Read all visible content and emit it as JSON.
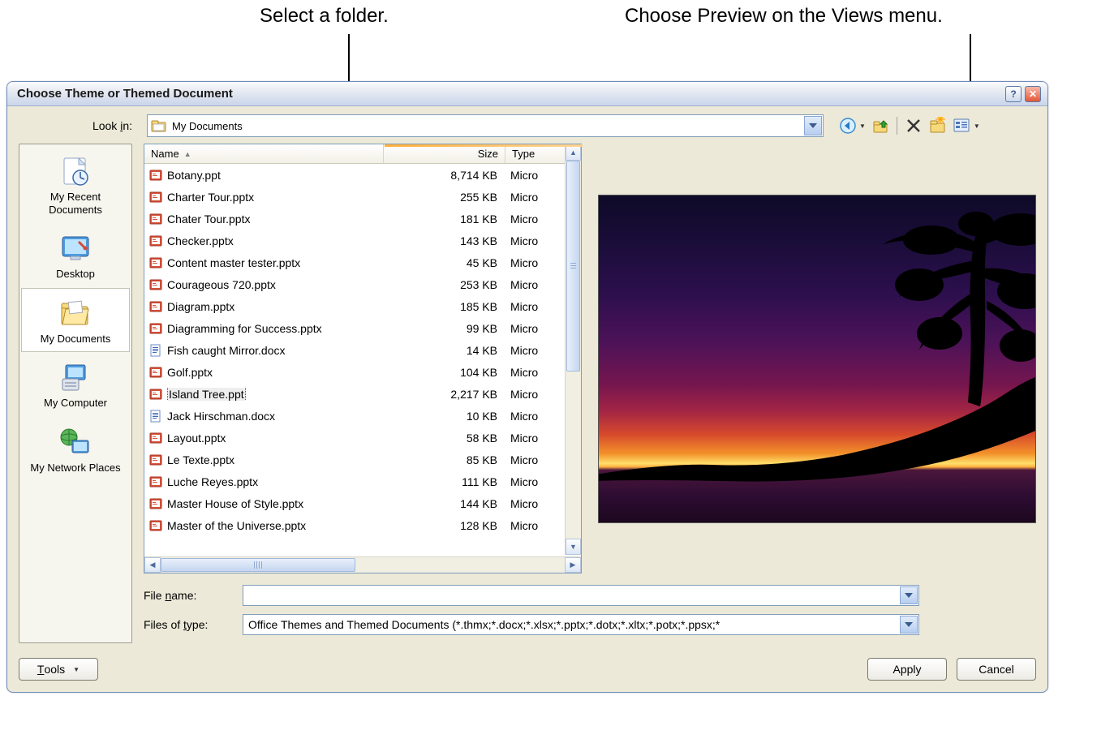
{
  "annotations": {
    "left": "Select a folder.",
    "right": "Choose Preview on the Views menu."
  },
  "dialog": {
    "title": "Choose Theme or Themed Document",
    "lookin_label": "Look in:",
    "lookin_value": "My Documents",
    "toolbar_icons": {
      "back": "back-icon",
      "up": "up-one-level-icon",
      "delete": "delete-icon",
      "newfolder": "new-folder-icon",
      "views": "views-icon"
    }
  },
  "places": [
    {
      "id": "recent",
      "label": "My Recent Documents"
    },
    {
      "id": "desktop",
      "label": "Desktop"
    },
    {
      "id": "mydocs",
      "label": "My Documents"
    },
    {
      "id": "mycomputer",
      "label": "My Computer"
    },
    {
      "id": "network",
      "label": "My Network Places"
    }
  ],
  "active_place": "mydocs",
  "columns": {
    "name": "Name",
    "size": "Size",
    "type": "Type"
  },
  "files": [
    {
      "name": "Botany.ppt",
      "size": "8,714 KB",
      "type": "Micro",
      "kind": "ppt"
    },
    {
      "name": "Charter Tour.pptx",
      "size": "255 KB",
      "type": "Micro",
      "kind": "ppt"
    },
    {
      "name": "Chater Tour.pptx",
      "size": "181 KB",
      "type": "Micro",
      "kind": "ppt"
    },
    {
      "name": "Checker.pptx",
      "size": "143 KB",
      "type": "Micro",
      "kind": "ppt"
    },
    {
      "name": "Content master tester.pptx",
      "size": "45 KB",
      "type": "Micro",
      "kind": "ppt"
    },
    {
      "name": "Courageous 720.pptx",
      "size": "253 KB",
      "type": "Micro",
      "kind": "ppt"
    },
    {
      "name": "Diagram.pptx",
      "size": "185 KB",
      "type": "Micro",
      "kind": "ppt"
    },
    {
      "name": "Diagramming for Success.pptx",
      "size": "99 KB",
      "type": "Micro",
      "kind": "ppt"
    },
    {
      "name": "Fish caught Mirror.docx",
      "size": "14 KB",
      "type": "Micro",
      "kind": "doc"
    },
    {
      "name": "Golf.pptx",
      "size": "104 KB",
      "type": "Micro",
      "kind": "ppt"
    },
    {
      "name": "Island Tree.ppt",
      "size": "2,217 KB",
      "type": "Micro",
      "kind": "ppt",
      "selected": true
    },
    {
      "name": "Jack Hirschman.docx",
      "size": "10 KB",
      "type": "Micro",
      "kind": "doc"
    },
    {
      "name": "Layout.pptx",
      "size": "58 KB",
      "type": "Micro",
      "kind": "ppt"
    },
    {
      "name": "Le Texte.pptx",
      "size": "85 KB",
      "type": "Micro",
      "kind": "ppt"
    },
    {
      "name": "Luche Reyes.pptx",
      "size": "111 KB",
      "type": "Micro",
      "kind": "ppt"
    },
    {
      "name": "Master House of Style.pptx",
      "size": "144 KB",
      "type": "Micro",
      "kind": "ppt"
    },
    {
      "name": "Master of the Universe.pptx",
      "size": "128 KB",
      "type": "Micro",
      "kind": "ppt"
    }
  ],
  "filename_label": "File name:",
  "filename_value": "",
  "filetype_label": "Files of type:",
  "filetype_value": "Office Themes and Themed Documents (*.thmx;*.docx;*.xlsx;*.pptx;*.dotx;*.xltx;*.potx;*.ppsx;*",
  "buttons": {
    "tools": "Tools",
    "apply": "Apply",
    "cancel": "Cancel"
  }
}
